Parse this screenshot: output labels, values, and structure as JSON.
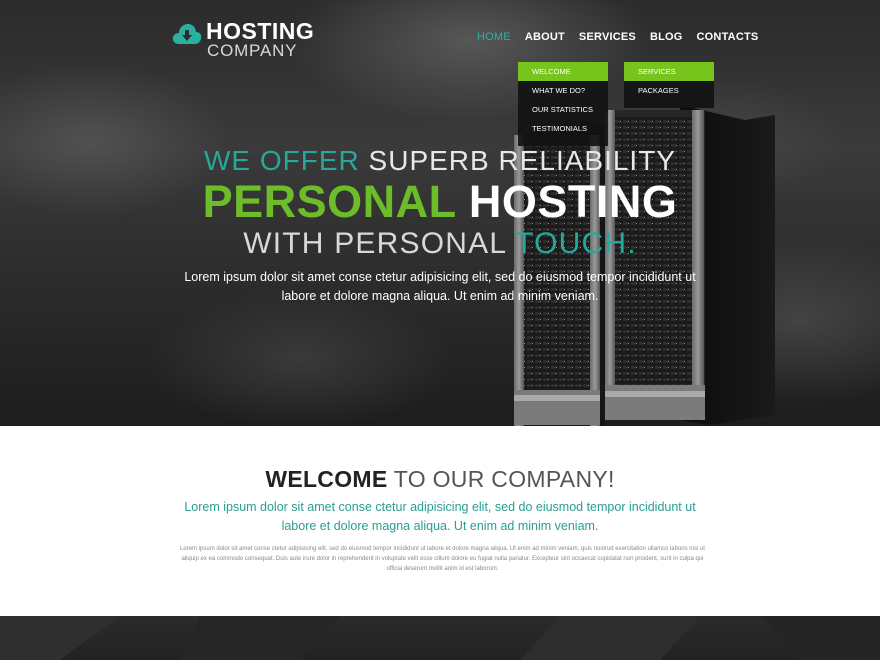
{
  "logo": {
    "main": "HOSTING",
    "sub": "COMPANY",
    "icon": "cloud-download-icon",
    "icon_color": "#2ab0a3"
  },
  "nav": {
    "items": [
      {
        "label": "HOME",
        "active": true
      },
      {
        "label": "ABOUT",
        "active": false
      },
      {
        "label": "SERVICES",
        "active": false
      },
      {
        "label": "BLOG",
        "active": false
      },
      {
        "label": "CONTACTS",
        "active": false
      }
    ],
    "about_dropdown": [
      "WELCOME",
      "WHAT WE DO?",
      "OUR STATISTICS",
      "TESTIMONIALS"
    ],
    "services_dropdown": [
      "SERVICES",
      "PACKAGES"
    ]
  },
  "hero": {
    "line1_teal": "WE OFFER",
    "line1_rest": " SUPERB RELIABILITY",
    "line2_green": "PERSONAL",
    "line2_rest": " HOSTING",
    "line3_rest": "WITH PERSONAL ",
    "line3_teal": "TOUCH.",
    "paragraph": "Lorem ipsum dolor sit amet conse ctetur adipisicing elit, sed do eiusmod tempor incididunt ut labore et dolore magna aliqua. Ut enim ad minim veniam."
  },
  "welcome": {
    "title_bold": "WELCOME",
    "title_light": " TO OUR COMPANY!",
    "lead": "Lorem ipsum dolor sit amet conse ctetur adipisicing elit, sed do eiusmod tempor incididunt ut labore et dolore magna aliqua. Ut enim ad minim veniam.",
    "body": "Lorem ipsum dolor sit amet conse ctetur adipisicing elit, sed do eiusmod tempor incididunt ut labore et dolore magna aliqua. Ut enim ad minim veniam, quis nostrud exercitation ullamco laboris nisi ut aliquip ex ea commodo consequat. Duis aute irure dolor in reprehenderit in voluptate velit esse cillum dolore eu fugiat nulla pariatur. Excepteur sint occaecat cupidatat non proident, sunt in culpa qui officia deserunt mollit anim id est laborum."
  },
  "colors": {
    "accent_teal": "#2ab0a3",
    "accent_green": "#77c51c"
  }
}
